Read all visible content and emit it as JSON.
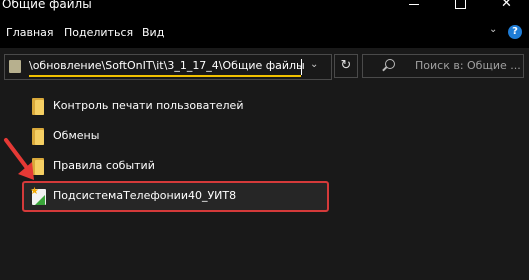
{
  "window": {
    "title": "Общие файлы"
  },
  "ribbon": {
    "tabs": [
      "Главная",
      "Поделиться",
      "Вид"
    ]
  },
  "address": {
    "path": "\\обновление\\SoftOnIT\\it\\3_1_17_4\\Общие файлы"
  },
  "search": {
    "placeholder": "Поиск в: Общие ..."
  },
  "items": [
    {
      "name": "Контроль печати пользователей",
      "type": "folder"
    },
    {
      "name": "Обмены",
      "type": "folder"
    },
    {
      "name": "Правила событий",
      "type": "folder"
    },
    {
      "name": "ПодсистемаТелефонии40_УИТ8",
      "type": "file",
      "icon": "app-file-icon",
      "highlighted": true
    }
  ],
  "colors": {
    "highlight_border": "#d43a3a",
    "address_underline": "#f2c200",
    "arrow": "#e53935"
  }
}
